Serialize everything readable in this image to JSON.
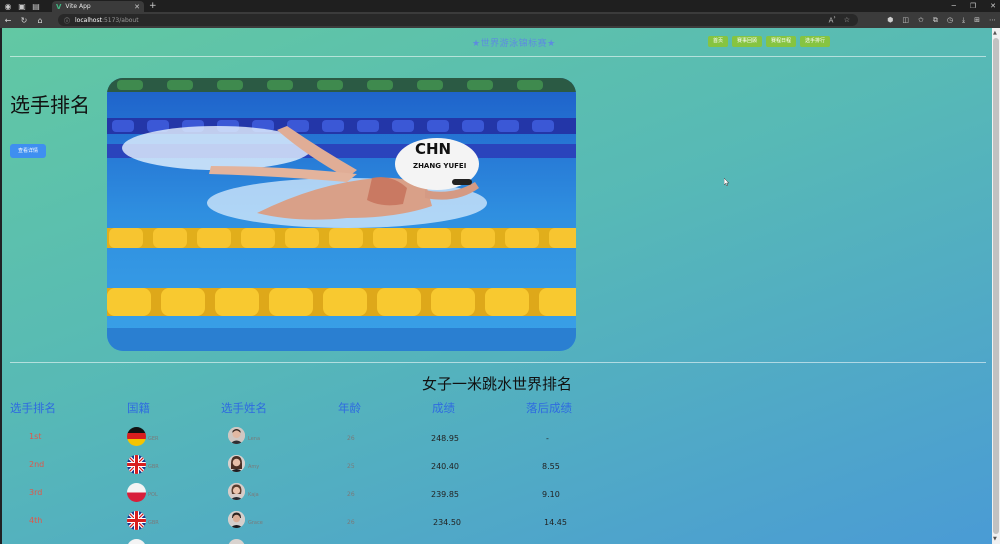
{
  "browser": {
    "tab_title": "Vite App",
    "address_host": "localhost",
    "address_path": ":5173/about"
  },
  "header": {
    "site_title": "★世界游泳锦标赛★",
    "menu": [
      "首页",
      "赛事回顾",
      "赛程日程",
      "选手排行"
    ]
  },
  "hero": {
    "title": "选手排名",
    "button_label": "查看详情",
    "photo_cap_text": "CHN",
    "photo_cap_name": "ZHANG YUFEI"
  },
  "ranking": {
    "title": "女子一米跳水世界排名",
    "headers": [
      "选手排名",
      "国籍",
      "选手姓名",
      "年龄",
      "成绩",
      "落后成绩"
    ],
    "rows": [
      {
        "rank": "1st",
        "flag": "germany",
        "nationality": "GER",
        "name": "Lena",
        "age": "26",
        "score": "248.95",
        "behind": "-"
      },
      {
        "rank": "2nd",
        "flag": "uk",
        "nationality": "GBR",
        "name": "Amy",
        "age": "25",
        "score": "240.40",
        "behind": "8.55"
      },
      {
        "rank": "3rd",
        "flag": "poland",
        "nationality": "POL",
        "name": "Kaja",
        "age": "26",
        "score": "239.85",
        "behind": "9.10"
      },
      {
        "rank": "4th",
        "flag": "uk",
        "nationality": "GBR",
        "name": "Grace",
        "age": "26",
        "score": "234.50",
        "behind": "14.45"
      }
    ]
  },
  "colors": {
    "accent_title": "#5d8be0",
    "menu_green": "#86c441",
    "button_blue": "#3f8ff0",
    "rank_red": "#e0574a",
    "header_blue": "#2f6be0"
  }
}
